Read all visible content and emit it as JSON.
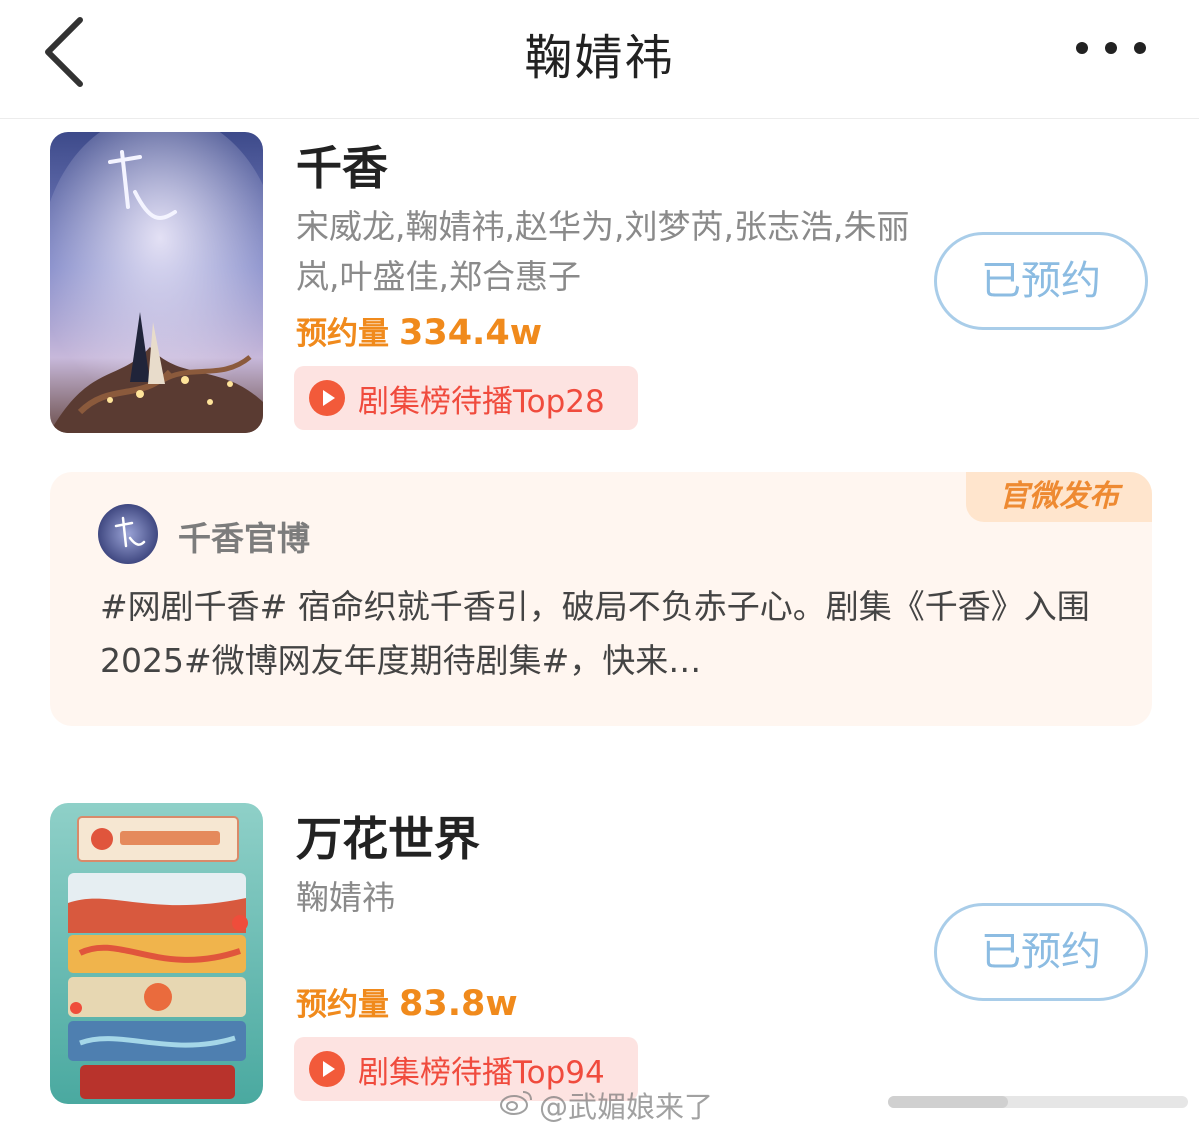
{
  "header": {
    "title": "鞠婧祎",
    "back_icon": "chevron-left-icon",
    "more_icon": "more-horizontal-icon"
  },
  "shows": [
    {
      "title": "千香",
      "cast": "宋威龙,鞠婧祎,赵华为,刘梦芮,张志浩,朱丽岚,叶盛佳,郑合惠子",
      "reserve_label": "预约量",
      "reserve_count": "334.4w",
      "rank_text": "剧集榜待播Top28",
      "button_label": "已预约"
    },
    {
      "title": "万花世界",
      "cast": "鞠婧祎",
      "reserve_label": "预约量",
      "reserve_count": "83.8w",
      "rank_text": "剧集榜待播Top94",
      "button_label": "已预约"
    }
  ],
  "post": {
    "tag": "官微发布",
    "author": "千香官博",
    "text": "#网剧千香# 宿命织就千香引，破局不负赤子心。剧集《千香》入围2025#微博网友年度期待剧集#，快来…"
  },
  "watermark": {
    "text": "@武媚娘来了",
    "icon": "weibo-icon"
  },
  "colors": {
    "accent_orange": "#f08a1c",
    "rank_red": "#f04b3d",
    "rank_bg": "#fde3e1",
    "button_blue": "#8cbce2",
    "post_bg": "#fff6f0"
  }
}
